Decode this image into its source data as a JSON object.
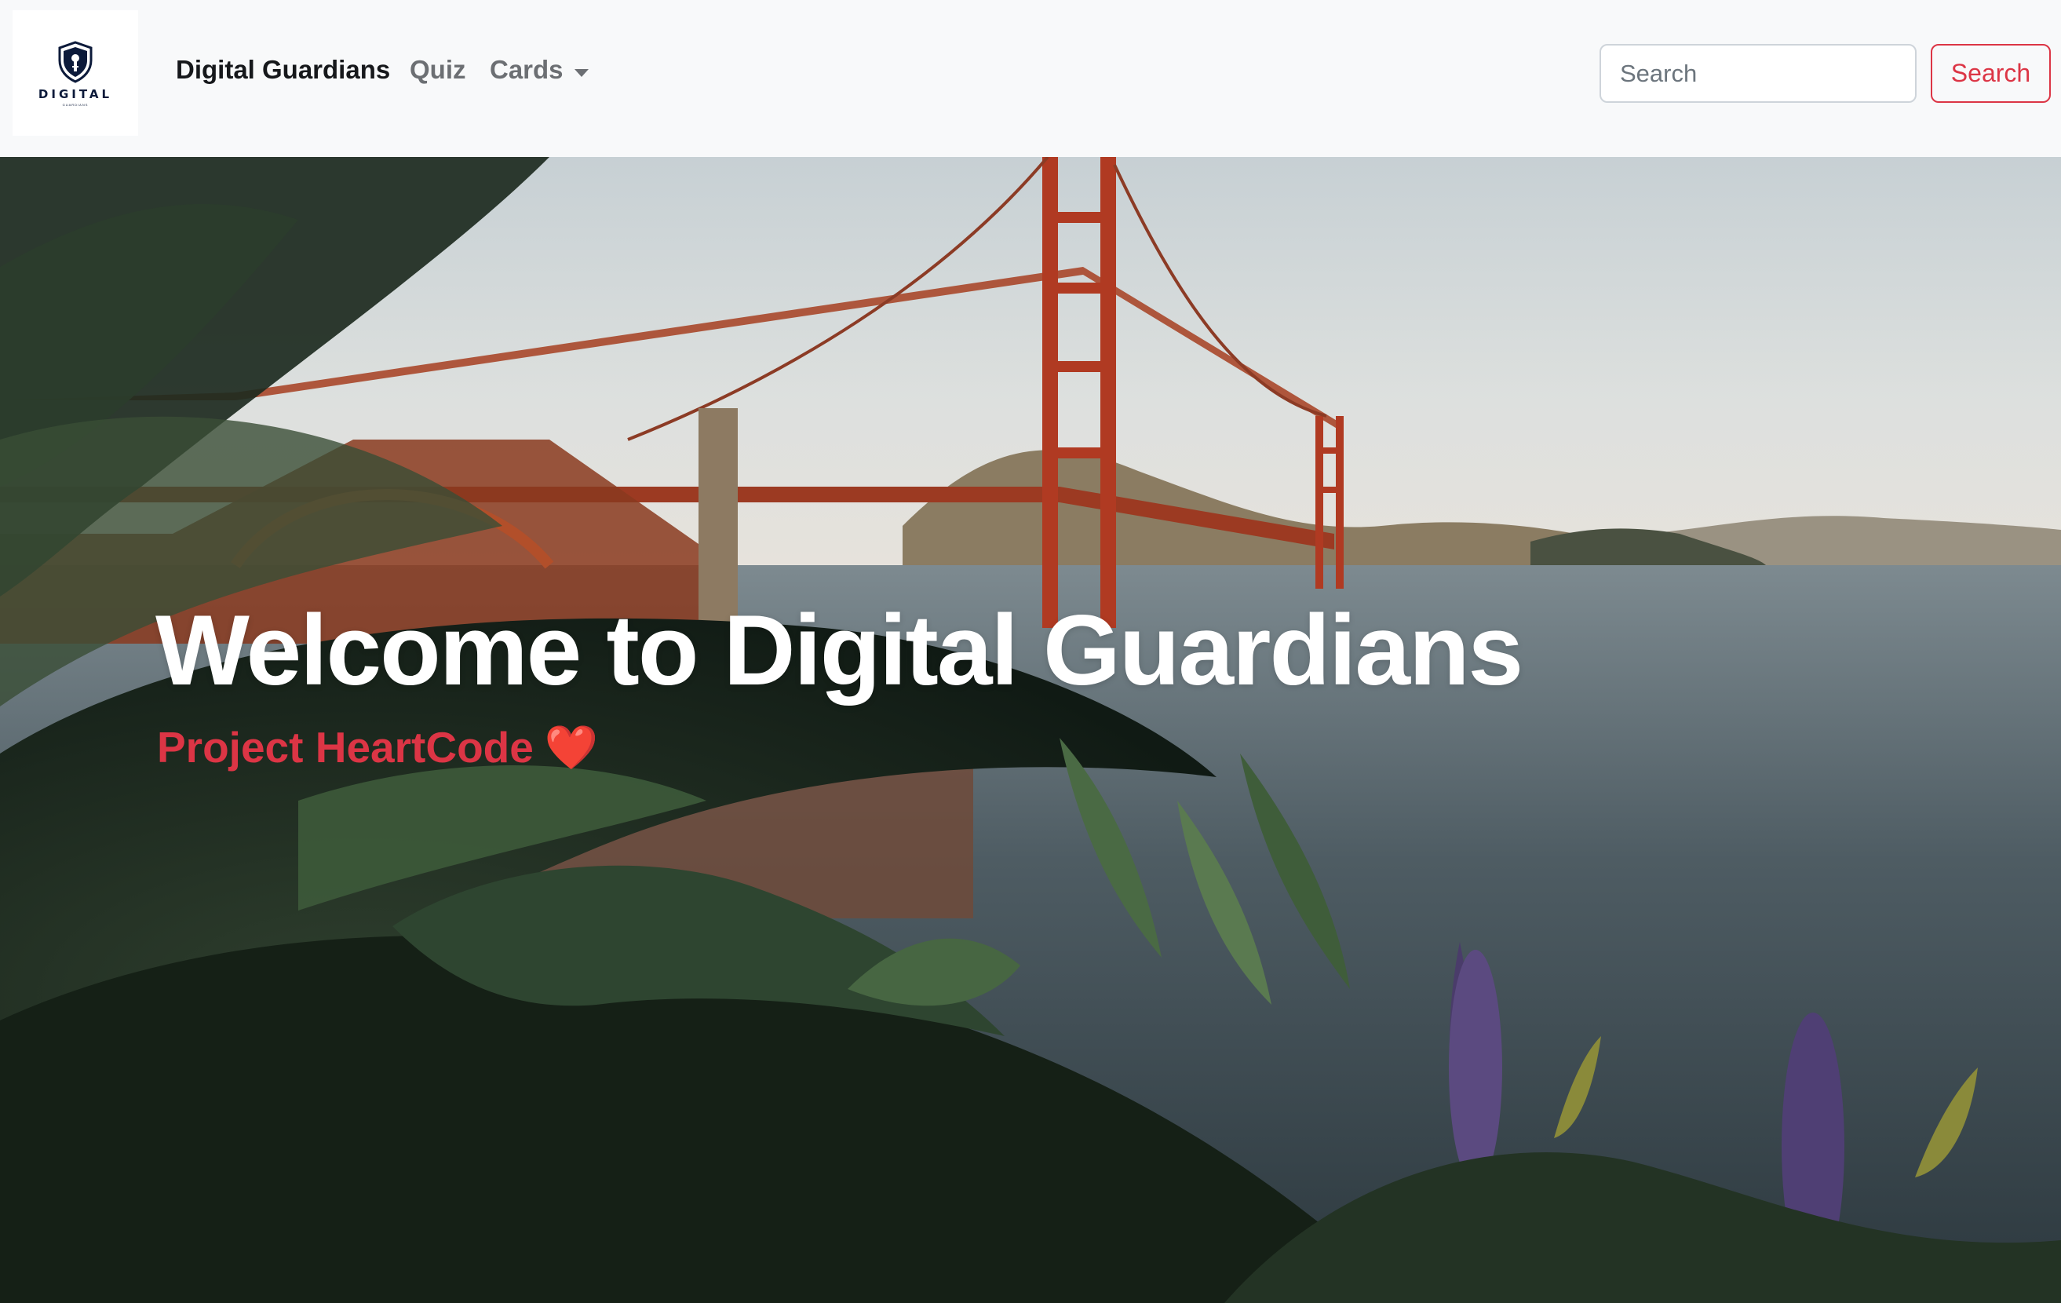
{
  "navbar": {
    "logo": {
      "text": "DIGITAL",
      "subtext": "GUARDIANS",
      "icon": "shield-icon"
    },
    "brand": "Digital Guardians",
    "links": [
      {
        "label": "Quiz"
      },
      {
        "label": "Cards",
        "icon": "caret-down-icon"
      }
    ],
    "search": {
      "placeholder": "Search",
      "value": "",
      "button_label": "Search"
    }
  },
  "hero": {
    "title": "Welcome to Digital Guardians",
    "subtitle": "Project HeartCode",
    "subtitle_icon": "heart-icon",
    "heart_glyph": "❤️"
  },
  "colors": {
    "navbar_bg": "#f8f9fa",
    "accent": "#dc3545",
    "brand_text": "#16181b",
    "nav_muted": "#6c6f73",
    "logo_navy": "#0c1a3a"
  }
}
